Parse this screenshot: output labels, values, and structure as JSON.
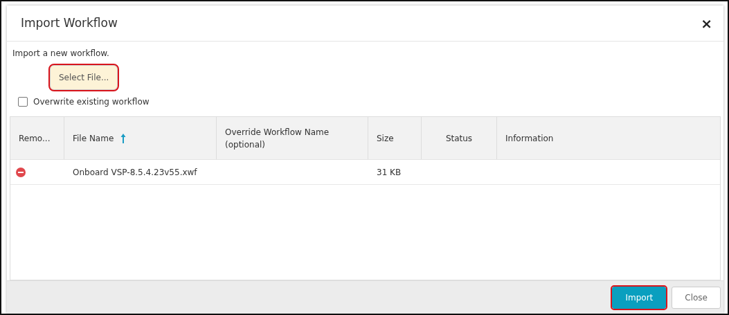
{
  "dialog": {
    "title": "Import Workflow",
    "close": "×"
  },
  "intro": "Import a new workflow.",
  "select_button": {
    "label": "Select File...",
    "highlighted": true
  },
  "overwrite": {
    "label": "Overwrite existing workflow",
    "checked": false
  },
  "table": {
    "columns": [
      {
        "label": "Remo...",
        "sorted": false
      },
      {
        "label": "File Name",
        "sorted": true
      },
      {
        "label": "Override Workflow Name (optional)",
        "sorted": false
      },
      {
        "label": "Size",
        "sorted": false
      },
      {
        "label": "Status",
        "sorted": false
      },
      {
        "label": "Information",
        "sorted": false
      }
    ],
    "rows": [
      {
        "remove": true,
        "file_name": "Onboard VSP-8.5.4.23v55.xwf",
        "override": "",
        "size": "31 KB",
        "status": "",
        "information": ""
      }
    ]
  },
  "buttons": [
    {
      "label": "Import",
      "kind": "primary",
      "highlighted": true
    },
    {
      "label": "Close",
      "kind": "secondary",
      "highlighted": false
    }
  ]
}
